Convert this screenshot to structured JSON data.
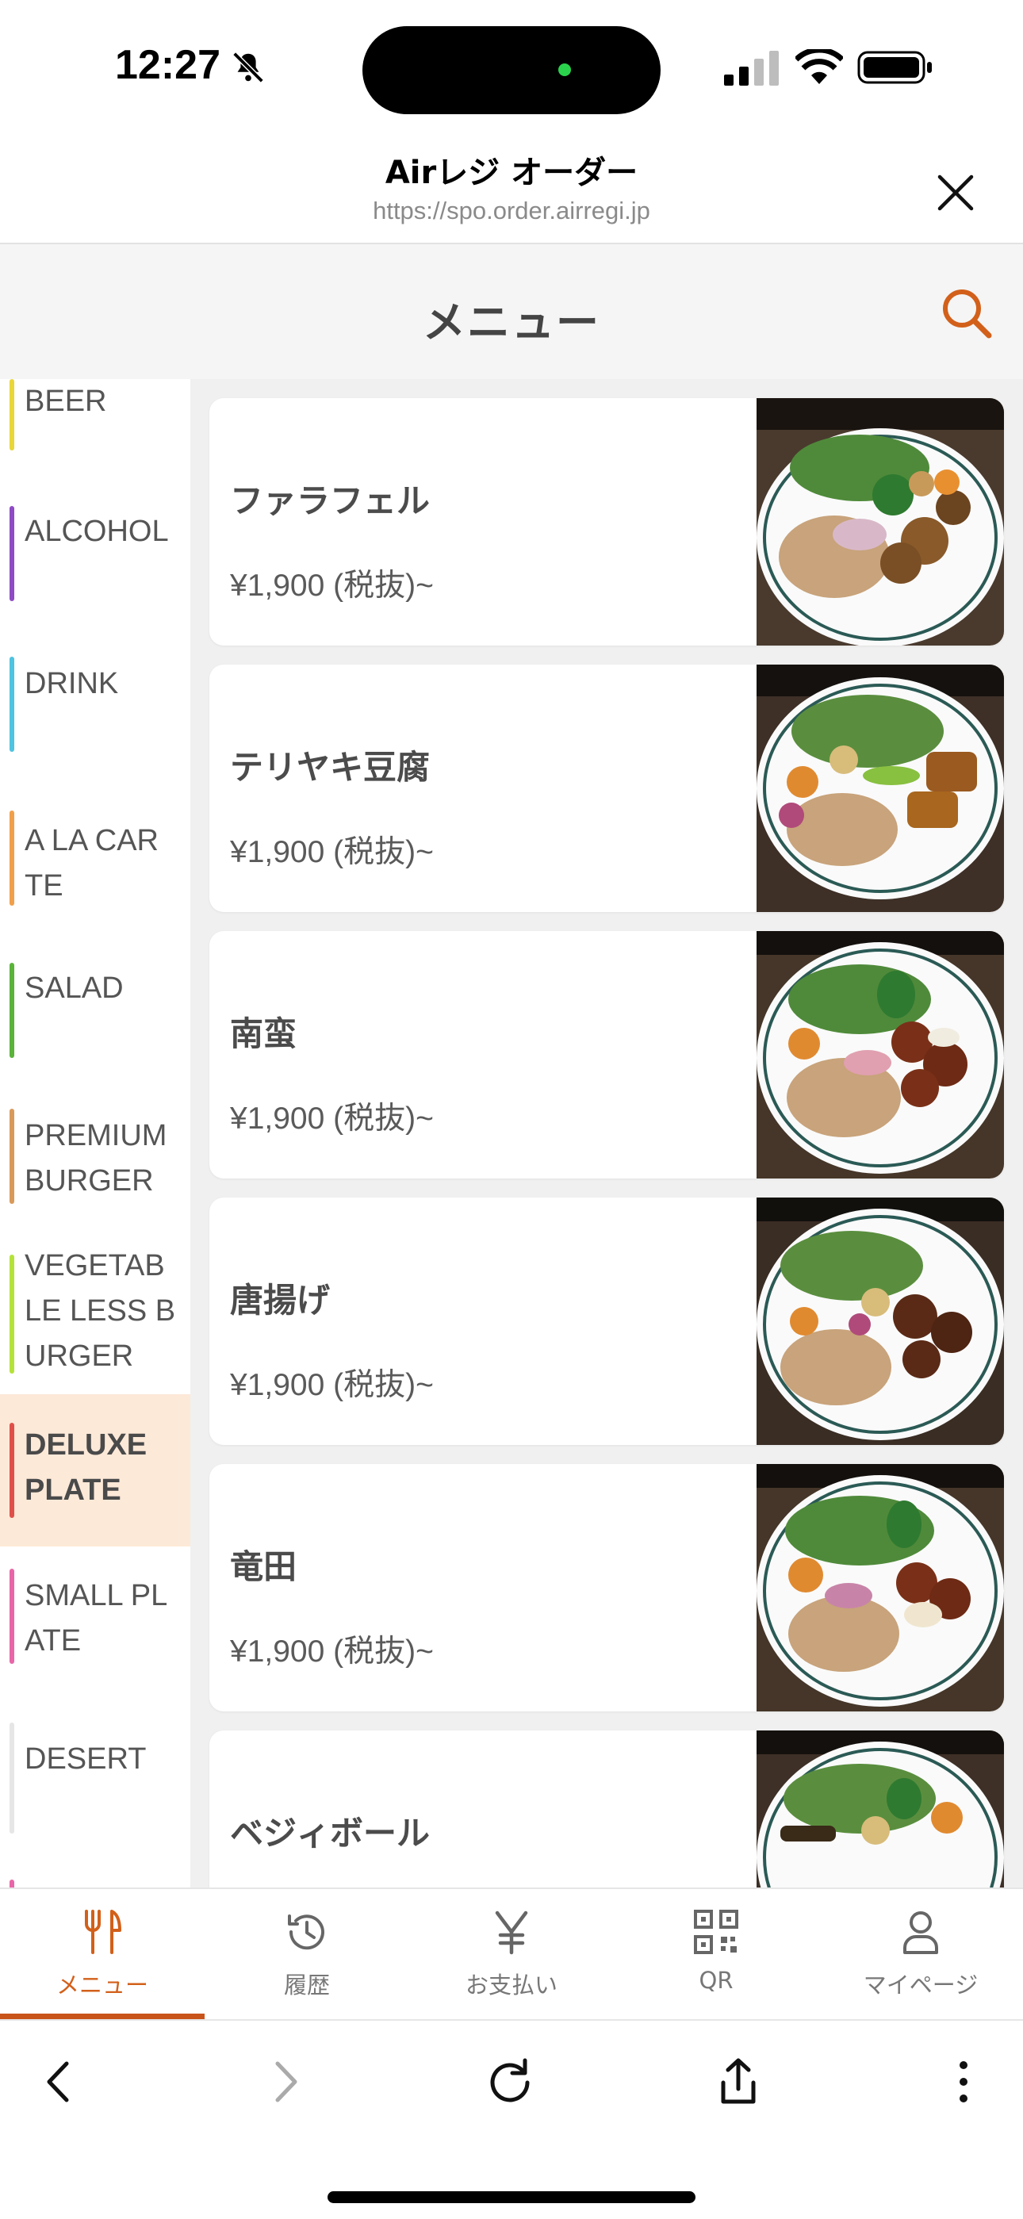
{
  "status": {
    "time": "12:27"
  },
  "browser": {
    "title": "Airレジ オーダー",
    "url": "https://spo.order.airregi.jp"
  },
  "header": {
    "title": "メニュー"
  },
  "categories": [
    {
      "label": "BEER",
      "color": "#e8d63a"
    },
    {
      "label": "ALCOHOL",
      "color": "#8e4bc4"
    },
    {
      "label": "DRINK",
      "color": "#4fc3e0"
    },
    {
      "label": "A LA CARTE",
      "color": "#f0a04b"
    },
    {
      "label": "SALAD",
      "color": "#5bb33a"
    },
    {
      "label": "PREMIUM BURGER",
      "color": "#d89a5a"
    },
    {
      "label": "VEGETABLE LESS BURGER",
      "color": "#b5e23a"
    },
    {
      "label": "DELUXE PLATE",
      "color": "#e0504a",
      "active": true
    },
    {
      "label": "SMALL PLATE",
      "color": "#e866a8"
    },
    {
      "label": "DESERT",
      "color": "#e6e6e6"
    }
  ],
  "menu_items": [
    {
      "name": "ファラフェル",
      "price": "¥1,900 (税抜)~"
    },
    {
      "name": "テリヤキ豆腐",
      "price": "¥1,900 (税抜)~"
    },
    {
      "name": "南蛮",
      "price": "¥1,900 (税抜)~"
    },
    {
      "name": "唐揚げ",
      "price": "¥1,900 (税抜)~"
    },
    {
      "name": "竜田",
      "price": "¥1,900 (税抜)~"
    },
    {
      "name": "ベジィボール",
      "price": ""
    }
  ],
  "tabs": [
    {
      "label": "メニュー",
      "icon": "fork-knife-icon",
      "active": true
    },
    {
      "label": "履歴",
      "icon": "history-icon"
    },
    {
      "label": "お支払い",
      "icon": "yen-icon"
    },
    {
      "label": "QR",
      "icon": "qr-icon"
    },
    {
      "label": "マイページ",
      "icon": "person-icon"
    }
  ],
  "colors": {
    "accent": "#c9541a",
    "active_category_bg": "#fde9d8"
  }
}
